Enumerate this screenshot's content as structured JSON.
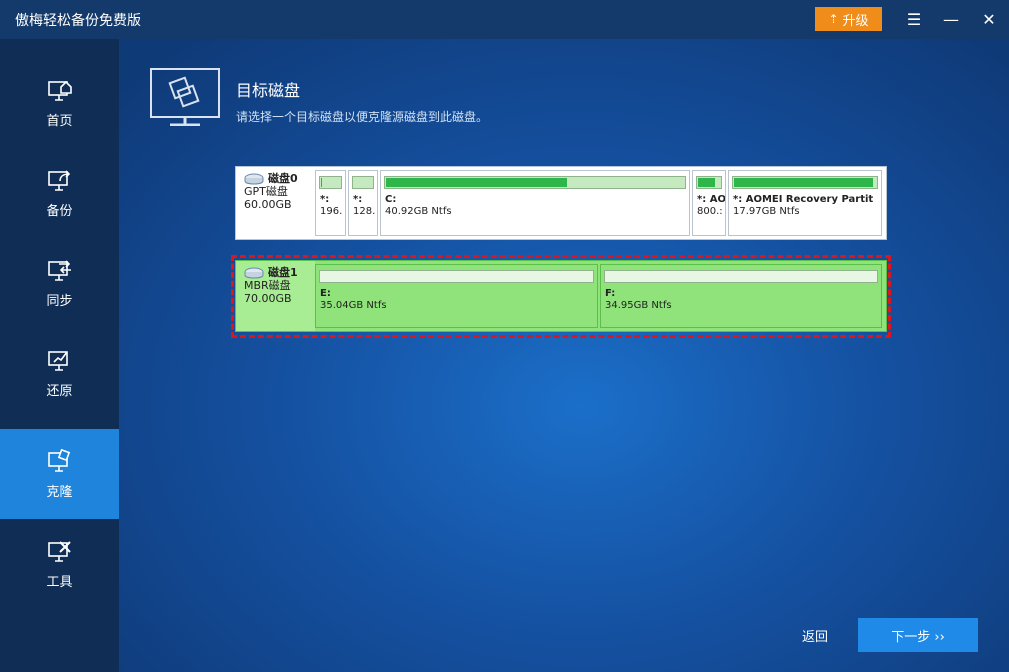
{
  "app": {
    "title": "傲梅轻松备份免费版"
  },
  "titlebar": {
    "upgrade_label": "升级"
  },
  "sidebar": {
    "items": [
      {
        "label": "首页",
        "icon": "home-icon"
      },
      {
        "label": "备份",
        "icon": "backup-icon"
      },
      {
        "label": "同步",
        "icon": "sync-icon"
      },
      {
        "label": "还原",
        "icon": "restore-icon"
      },
      {
        "label": "克隆",
        "icon": "clone-icon",
        "active": true
      },
      {
        "label": "工具",
        "icon": "tools-icon"
      }
    ]
  },
  "page": {
    "title": "目标磁盘",
    "subtitle": "请选择一个目标磁盘以便克隆源磁盘到此磁盘。"
  },
  "disks": [
    {
      "name": "磁盘0",
      "type": "GPT磁盘",
      "size": "60.00GB",
      "partitions": [
        {
          "label": "*:",
          "size": "196.",
          "used_fraction": 0.1
        },
        {
          "label": "*:",
          "size": "128.",
          "used_fraction": 0.0
        },
        {
          "label": "C:",
          "size": "40.92GB Ntfs",
          "used_fraction": 0.61
        },
        {
          "label": "*: AO",
          "size": "800.:",
          "used_fraction": 0.8
        },
        {
          "label": "*: AOMEI Recovery Partit",
          "size": "17.97GB Ntfs",
          "used_fraction": 0.98
        }
      ]
    },
    {
      "name": "磁盘1",
      "type": "MBR磁盘",
      "size": "70.00GB",
      "selected": true,
      "partitions": [
        {
          "label": "E:",
          "size": "35.04GB Ntfs",
          "used_fraction": 0.0
        },
        {
          "label": "F:",
          "size": "34.95GB Ntfs",
          "used_fraction": 0.0
        }
      ]
    }
  ],
  "footer": {
    "back_label": "返回",
    "next_label": "下一步 ››"
  },
  "colors": {
    "accent": "#1f84dc",
    "upgrade": "#f08c1a",
    "selection_outline": "#e0141d",
    "selected_disk": "#8fe37a"
  }
}
